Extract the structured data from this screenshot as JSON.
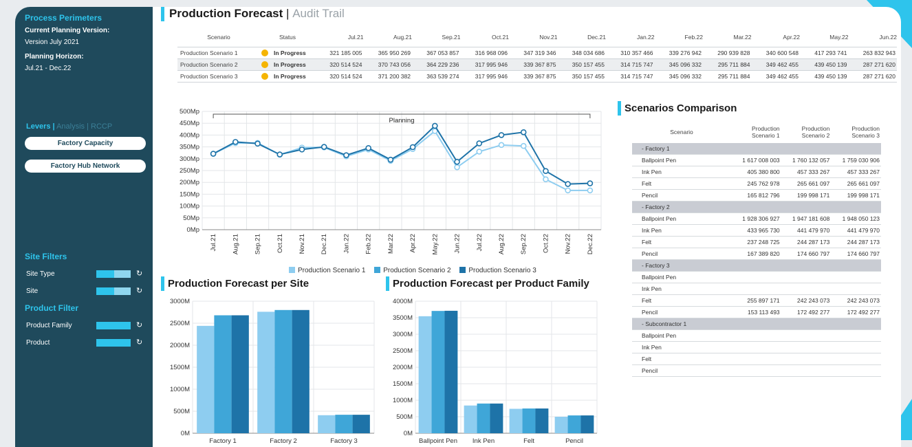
{
  "sidebar": {
    "perimeters_title": "Process Perimeters",
    "planning_version_label": "Current Planning Version:",
    "planning_version_value": "Version July 2021",
    "horizon_label": "Planning Horizon:",
    "horizon_value": "Jul.21 - Dec.22",
    "tabs": [
      "Levers",
      "|",
      "Analysis",
      "|",
      "RCCP"
    ],
    "buttons": [
      "Factory Capacity",
      "Factory Hub Network"
    ],
    "site_filters_title": "Site Filters",
    "site_filters": [
      "Site Type",
      "Site"
    ],
    "product_filter_title": "Product Filter",
    "product_filters": [
      "Product Family",
      "Product"
    ],
    "refresh_glyph": "↻"
  },
  "header": {
    "title": "Production Forecast",
    "separator": "|",
    "subtitle": "Audit Trail"
  },
  "scenario_table": {
    "col_scenario": "Scenario",
    "col_status": "Status",
    "months": [
      "Jul.21",
      "Aug.21",
      "Sep.21",
      "Oct.21",
      "Nov.21",
      "Dec.21",
      "Jan.22",
      "Feb.22",
      "Mar.22",
      "Apr.22",
      "May.22",
      "Jun.22"
    ],
    "rows": [
      {
        "name": "Production Scenario 1",
        "status": "In Progress",
        "values": [
          "321 185 005",
          "365 950 269",
          "367 053 857",
          "316 968 096",
          "347 319 346",
          "348 034 686",
          "310 357 466",
          "339 276 942",
          "290 939 828",
          "340 600 548",
          "417 293 741",
          "263 832 943"
        ]
      },
      {
        "name": "Production Scenario 2",
        "status": "In Progress",
        "values": [
          "320 514 524",
          "370 743 056",
          "364 229 236",
          "317 995 946",
          "339 367 875",
          "350 157 455",
          "314 715 747",
          "345 096 332",
          "295 711 884",
          "349 462 455",
          "439 450 139",
          "287 271 620"
        ]
      },
      {
        "name": "Production Scenario 3",
        "status": "In Progress",
        "values": [
          "320 514 524",
          "371 200 382",
          "363 539 274",
          "317 995 946",
          "339 367 875",
          "350 157 455",
          "314 715 747",
          "345 096 332",
          "295 711 884",
          "349 462 455",
          "439 450 139",
          "287 271 620"
        ]
      }
    ]
  },
  "legend": [
    "Production Scenario 1",
    "Production Scenario 2",
    "Production Scenario 3"
  ],
  "colors": {
    "s1": "#8ecdf0",
    "s2": "#3fa6d8",
    "s3": "#1e73a8",
    "accent": "#2ec4ec",
    "status_dot": "#f5b400"
  },
  "line_chart": {
    "planning_label": "Planning",
    "yticks": [
      "500Mp",
      "450Mp",
      "400Mp",
      "350Mp",
      "300Mp",
      "250Mp",
      "200Mp",
      "150Mp",
      "100Mp",
      "50Mp",
      "0Mp"
    ]
  },
  "site_chart": {
    "title": "Production Forecast per Site",
    "yticks": [
      "3000M",
      "2500M",
      "2000M",
      "1500M",
      "1000M",
      "500M",
      "0M"
    ]
  },
  "family_chart": {
    "title": "Production Forecast per Product Family",
    "yticks": [
      "4000M",
      "3500M",
      "3000M",
      "2500M",
      "2000M",
      "1500M",
      "1000M",
      "500M",
      "0M"
    ]
  },
  "chart_data": [
    {
      "type": "line",
      "x": [
        "Jul.21",
        "Aug.21",
        "Sep.21",
        "Oct.21",
        "Nov.21",
        "Dec.21",
        "Jan.22",
        "Feb.22",
        "Mar.22",
        "Apr.22",
        "May.22",
        "Jun.22",
        "Jul.22",
        "Aug.22",
        "Sep.22",
        "Oct.22",
        "Nov.22",
        "Dec.22"
      ],
      "series": [
        {
          "name": "Production Scenario 1",
          "values": [
            321,
            366,
            367,
            317,
            347,
            348,
            310,
            339,
            291,
            341,
            417,
            264,
            330,
            358,
            354,
            213,
            166,
            166
          ]
        },
        {
          "name": "Production Scenario 3",
          "values": [
            321,
            371,
            364,
            318,
            339,
            350,
            315,
            345,
            296,
            349,
            439,
            287,
            365,
            400,
            412,
            248,
            193,
            196
          ]
        }
      ],
      "ylabel": "",
      "ylim": [
        0,
        500
      ],
      "grid": true
    },
    {
      "type": "bar",
      "categories": [
        "Factory 1",
        "Factory 2",
        "Factory 3"
      ],
      "series": [
        {
          "name": "Production Scenario 1",
          "values": [
            2440,
            2760,
            410
          ]
        },
        {
          "name": "Production Scenario 2",
          "values": [
            2680,
            2800,
            420
          ]
        },
        {
          "name": "Production Scenario 3",
          "values": [
            2680,
            2800,
            420
          ]
        }
      ],
      "ylim": [
        0,
        3000
      ]
    },
    {
      "type": "bar",
      "categories": [
        "Ballpoint Pen",
        "Ink Pen",
        "Felt",
        "Pencil"
      ],
      "series": [
        {
          "name": "Production Scenario 1",
          "values": [
            3545,
            840,
            740,
            500
          ]
        },
        {
          "name": "Production Scenario 2",
          "values": [
            3705,
            900,
            750,
            540
          ]
        },
        {
          "name": "Production Scenario 3",
          "values": [
            3710,
            900,
            750,
            540
          ]
        }
      ],
      "ylim": [
        0,
        4000
      ]
    }
  ],
  "comparison": {
    "title": "Scenarios Comparison",
    "col_scenario": "Scenario",
    "cols": [
      [
        "Production",
        "Scenario 1"
      ],
      [
        "Production",
        "Scenario 2"
      ],
      [
        "Production",
        "Scenario 3"
      ]
    ],
    "groups": [
      {
        "name": "- Factory 1",
        "rows": [
          [
            "Ballpoint Pen",
            "1 617 008 003",
            "1 760 132 057",
            "1 759 030 906"
          ],
          [
            "Ink Pen",
            "405 380 800",
            "457 333 267",
            "457 333 267"
          ],
          [
            "Felt",
            "245 762 978",
            "265 661 097",
            "265 661 097"
          ],
          [
            "Pencil",
            "165 812 796",
            "199 998 171",
            "199 998 171"
          ]
        ]
      },
      {
        "name": "- Factory 2",
        "rows": [
          [
            "Ballpoint Pen",
            "1 928 306 927",
            "1 947 181 608",
            "1 948 050 123"
          ],
          [
            "Ink Pen",
            "433 965 730",
            "441 479 970",
            "441 479 970"
          ],
          [
            "Felt",
            "237 248 725",
            "244 287 173",
            "244 287 173"
          ],
          [
            "Pencil",
            "167 389 820",
            "174 660 797",
            "174 660 797"
          ]
        ]
      },
      {
        "name": "- Factory 3",
        "rows": [
          [
            "Ballpoint Pen",
            "",
            "",
            ""
          ],
          [
            "Ink Pen",
            "",
            "",
            ""
          ],
          [
            "Felt",
            "255 897 171",
            "242 243 073",
            "242 243 073"
          ],
          [
            "Pencil",
            "153 113 493",
            "172 492 277",
            "172 492 277"
          ]
        ]
      },
      {
        "name": "- Subcontractor 1",
        "rows": [
          [
            "Ballpoint Pen",
            "",
            "",
            ""
          ],
          [
            "Ink Pen",
            "",
            "",
            ""
          ],
          [
            "Felt",
            "",
            "",
            ""
          ],
          [
            "Pencil",
            "",
            "",
            ""
          ]
        ]
      }
    ]
  }
}
